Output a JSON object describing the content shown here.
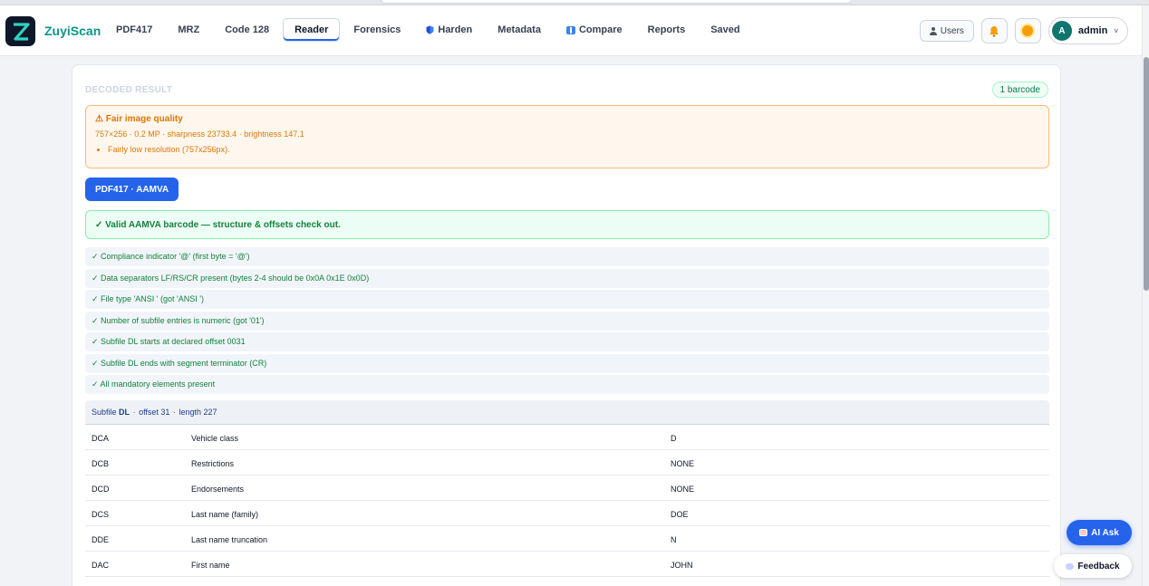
{
  "app": {
    "brand": "ZuyiScan"
  },
  "nav": {
    "items": [
      {
        "label": "PDF417",
        "icon": ""
      },
      {
        "label": "MRZ",
        "icon": ""
      },
      {
        "label": "Code 128",
        "icon": ""
      },
      {
        "label": "Reader",
        "icon": "",
        "active": true
      },
      {
        "label": "Forensics",
        "icon": ""
      },
      {
        "label": "Harden",
        "icon": "shield-icon"
      },
      {
        "label": "Metadata",
        "icon": ""
      },
      {
        "label": "Compare",
        "icon": "compare-icon"
      },
      {
        "label": "Reports",
        "icon": ""
      },
      {
        "label": "Saved",
        "icon": ""
      }
    ]
  },
  "header": {
    "users_label": "Users",
    "user_initial": "A",
    "user_name": "admin",
    "caret": "˅"
  },
  "result": {
    "section_title": "DECODED RESULT",
    "count_badge": "1 barcode",
    "quality": {
      "title": "⚠ Fair image quality",
      "meta": "757×256 · 0.2 MP · sharpness 23733.4 · brightness 147.1",
      "issues": [
        "Fairly low resolution (757x256px)."
      ]
    },
    "format_label": "PDF417 · AAMVA",
    "valid_message": "✓ Valid AAMVA barcode — structure & offsets check out.",
    "checks": [
      "✓ Compliance indicator '@' (first byte = '@')",
      "✓ Data separators LF/RS/CR present (bytes 2-4 should be 0x0A 0x1E 0x0D)",
      "✓ File type 'ANSI ' (got 'ANSI ')",
      "✓ Number of subfile entries is numeric (got '01')",
      "✓ Subfile DL starts at declared offset 0031",
      "✓ Subfile DL ends with segment terminator (CR)",
      "✓ All mandatory elements present"
    ],
    "subfile": {
      "prefix": "Subfile",
      "name": "DL",
      "offset": "offset 31",
      "length": "length 227"
    },
    "fields": [
      {
        "code": "DCA",
        "label": "Vehicle class",
        "value": "D"
      },
      {
        "code": "DCB",
        "label": "Restrictions",
        "value": "NONE"
      },
      {
        "code": "DCD",
        "label": "Endorsements",
        "value": "NONE"
      },
      {
        "code": "DCS",
        "label": "Last name (family)",
        "value": "DOE"
      },
      {
        "code": "DDE",
        "label": "Last name truncation",
        "value": "N"
      },
      {
        "code": "DAC",
        "label": "First name",
        "value": "JOHN"
      }
    ]
  },
  "floating": {
    "ai_ask": "AI Ask",
    "feedback": "Feedback"
  },
  "colors": {
    "accent": "#2563eb",
    "brand": "#0d9488",
    "success": "#15803d",
    "warning": "#d97706"
  }
}
